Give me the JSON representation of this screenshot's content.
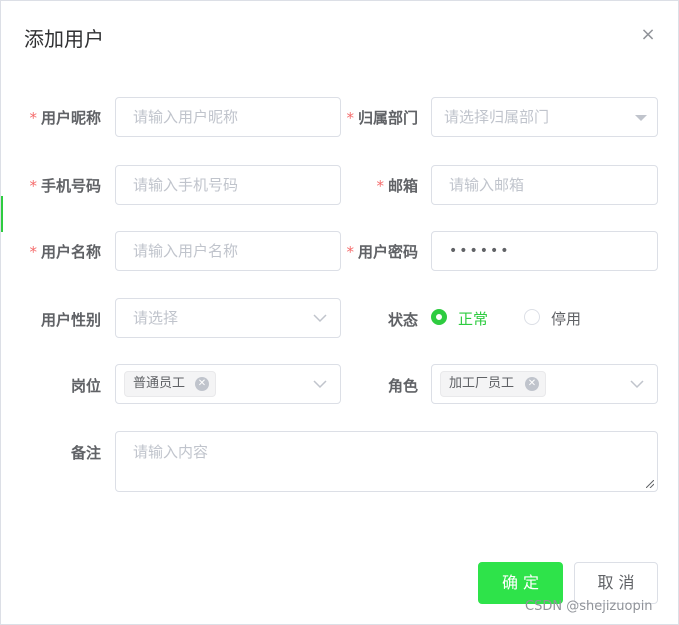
{
  "dialog": {
    "title": "添加用户",
    "close_label": "×"
  },
  "required_mark": "*",
  "form": {
    "nickname": {
      "label": "用户昵称",
      "placeholder": "请输入用户昵称"
    },
    "dept": {
      "label": "归属部门",
      "placeholder": "请选择归属部门"
    },
    "phone": {
      "label": "手机号码",
      "placeholder": "请输入手机号码"
    },
    "email": {
      "label": "邮箱",
      "placeholder": "请输入邮箱"
    },
    "username": {
      "label": "用户名称",
      "placeholder": "请输入用户名称"
    },
    "password": {
      "label": "用户密码",
      "value": "••••••"
    },
    "gender": {
      "label": "用户性别",
      "placeholder": "请选择"
    },
    "status": {
      "label": "状态",
      "options": [
        "正常",
        "停用"
      ],
      "selected": "正常"
    },
    "post": {
      "label": "岗位",
      "tags": [
        "普通员工"
      ]
    },
    "role": {
      "label": "角色",
      "tags": [
        "加工厂员工"
      ]
    },
    "remark": {
      "label": "备注",
      "placeholder": "请输入内容"
    }
  },
  "buttons": {
    "confirm": "确 定",
    "cancel": "取 消"
  },
  "watermark": "CSDN @shejizuopin",
  "colors": {
    "accent": "#2ee34a",
    "required": "#f56c6c",
    "border": "#dcdfe6",
    "placeholder": "#c0c4cc"
  }
}
